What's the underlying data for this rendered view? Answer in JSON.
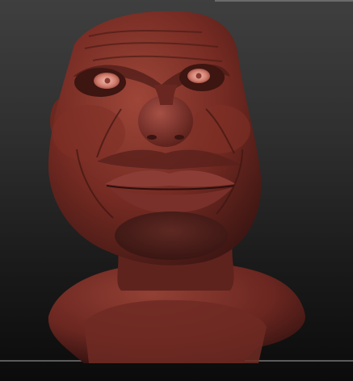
{
  "viewport": {
    "background": "#1b1b1b",
    "accent": "#6b6b6b"
  },
  "model": {
    "material_color": "#7a2b22",
    "highlight_color": "#b15a4c",
    "shadow_color": "#3a1410"
  }
}
